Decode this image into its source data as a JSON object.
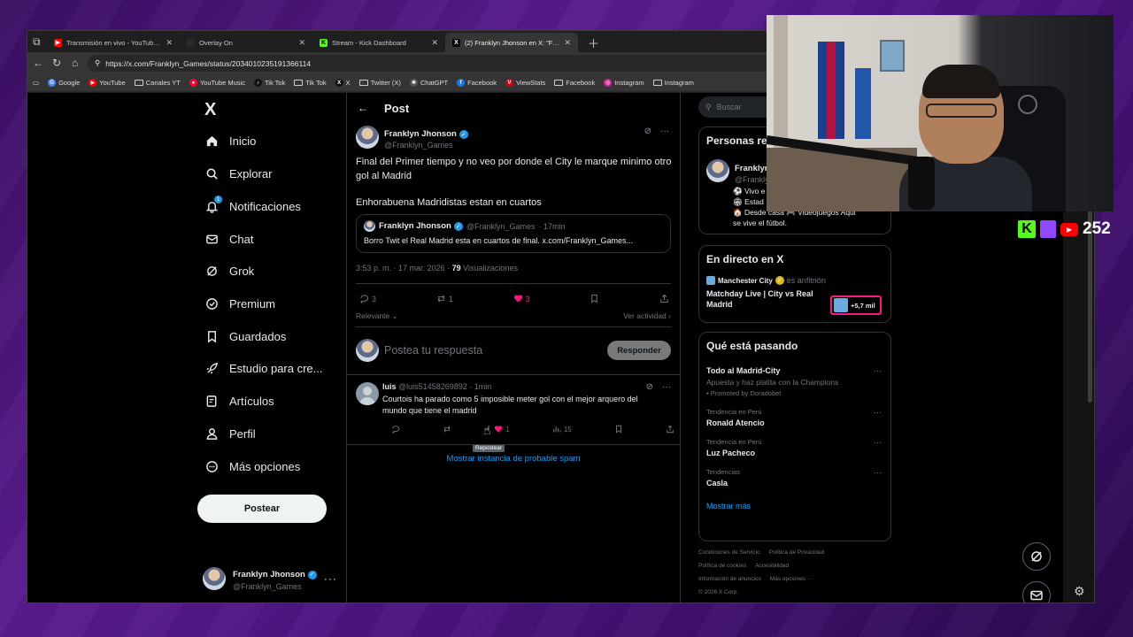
{
  "browser": {
    "tabs": [
      {
        "title": "Transmisión en vivo - YouTube St",
        "favicon_color": "#ff0000",
        "favicon_glyph": "▶"
      },
      {
        "title": "Overlay On",
        "favicon_color": "#2a2a2a",
        "favicon_glyph": ""
      },
      {
        "title": "Stream - Kick Dashboard",
        "favicon_color": "#53fc18",
        "favicon_glyph": "K"
      },
      {
        "title": "(2) Franklyn Jhonson en X: \"Final d",
        "favicon_color": "#000000",
        "favicon_glyph": "X",
        "active": true
      }
    ],
    "url": "https://x.com/Franklyn_Games/status/2034010235191366114",
    "bookmarks": [
      {
        "label": "Google",
        "icon": "google-icon",
        "color": "#4285f4"
      },
      {
        "label": "YouTube",
        "icon": "youtube-icon",
        "color": "#ff0000"
      },
      {
        "label": "Canales YT",
        "icon": "folder-icon"
      },
      {
        "label": "YouTube Music",
        "icon": "youtube-music-icon",
        "color": "#ff0033"
      },
      {
        "label": "Tik Tok",
        "icon": "tiktok-icon",
        "color": "#111111"
      },
      {
        "label": "Tik Tok",
        "icon": "folder-icon"
      },
      {
        "label": "X",
        "icon": "x-icon",
        "color": "#111111"
      },
      {
        "label": "Twitter (X)",
        "icon": "folder-icon"
      },
      {
        "label": "ChatGPT",
        "icon": "chatgpt-icon",
        "color": "#555555"
      },
      {
        "label": "Facebook",
        "icon": "facebook-icon",
        "color": "#1877f2"
      },
      {
        "label": "ViewStats",
        "icon": "viewstats-icon",
        "color": "#d0021b"
      },
      {
        "label": "Facebook",
        "icon": "folder-icon"
      },
      {
        "label": "Instagram",
        "icon": "instagram-icon",
        "color": "#d6249f"
      },
      {
        "label": "Instagram",
        "icon": "folder-icon"
      }
    ]
  },
  "sidebar": {
    "logo": "X",
    "items": [
      {
        "label": "Inicio",
        "icon": "home-icon"
      },
      {
        "label": "Explorar",
        "icon": "search-icon"
      },
      {
        "label": "Notificaciones",
        "icon": "bell-icon",
        "badge": "1"
      },
      {
        "label": "Chat",
        "icon": "mail-icon"
      },
      {
        "label": "Grok",
        "icon": "grok-icon"
      },
      {
        "label": "Premium",
        "icon": "premium-icon"
      },
      {
        "label": "Guardados",
        "icon": "bookmark-icon"
      },
      {
        "label": "Estudio para cre...",
        "icon": "rocket-icon"
      },
      {
        "label": "Artículos",
        "icon": "articles-icon"
      },
      {
        "label": "Perfil",
        "icon": "person-icon"
      },
      {
        "label": "Más opciones",
        "icon": "more-circle-icon"
      }
    ],
    "post_button": "Postear",
    "account": {
      "name": "Franklyn Jhonson",
      "handle": "@Franklyn_Games"
    }
  },
  "main": {
    "header": "Post",
    "post": {
      "author": "Franklyn Jhonson",
      "handle": "@Franklyn_Games",
      "text_line1": "Final del Primer tiempo y no veo por donde el City le marque minimo otro gol al Madrid",
      "text_line2": "Enhorabuena Madridistas estan en cuartos",
      "quote": {
        "author": "Franklyn Jhonson",
        "handle": "@Franklyn_Games",
        "time": "· 17min",
        "text": "Borro Twit el Real Madrid esta en cuartos de final. x.com/Franklyn_Games..."
      },
      "timestamp": "3:53 p. m. · 17 mar. 2026 · ",
      "views_count": "79",
      "views_label": " Visualizaciones",
      "replies": "3",
      "reposts": "1",
      "likes": "3"
    },
    "sort_label": "Relevante",
    "activity_label": "Ver actividad",
    "compose_placeholder": "Postea tu respuesta",
    "reply_button": "Responder",
    "reply": {
      "author": "luis",
      "handle": "@luis51458269892",
      "time": "· 1min",
      "text": "Courtois ha parado como 5 imposible meter gol con el mejor arquero del mundo que tiene el madrid",
      "likes": "1",
      "views": "15",
      "tooltip": "Repostear"
    },
    "spam_link": "Mostrar instancia de probable spam"
  },
  "right": {
    "search_placeholder": "Buscar",
    "who_to_follow_title": "Personas re",
    "profile": {
      "name": "Franklyn",
      "handle": "@Frankly",
      "bio1": "⚽ Vivo e",
      "bio2": "🏟 Estad",
      "bio3": "🏠 Desde casa 🎮 Videojuegos Aqui",
      "bio4": "se vive el fútbol."
    },
    "live": {
      "title": "En directo en X",
      "host_name": "Manchester City",
      "host_suffix": "es anfitrión",
      "event": "Matchday Live | City vs Real Madrid",
      "views": "+5,7 mil"
    },
    "trends": {
      "title": "Qué está pasando",
      "items": [
        {
          "context": "",
          "name": "Todo al Madrid-City",
          "sub": "Apuesta y haz platita con la Champions",
          "promo": "Promoted by Doradobet"
        },
        {
          "context": "Tendencia en Perú",
          "name": "Ronald Atencio",
          "sub": "",
          "promo": ""
        },
        {
          "context": "Tendencia en Perú",
          "name": "Luz Pacheco",
          "sub": "",
          "promo": ""
        },
        {
          "context": "Tendencias",
          "name": "Casla",
          "sub": "",
          "promo": ""
        }
      ],
      "show_more": "Mostrar más"
    },
    "footer": {
      "l1a": "Condiciones de Servicio",
      "l1b": "Política de Privacidad",
      "l2a": "Política de cookies",
      "l2b": "Accesibilidad",
      "l3a": "Información de anuncios",
      "l3b": "Más opciones ···",
      "l4": "© 2026 X Corp."
    }
  },
  "stream_overlay": {
    "viewer_count": "252"
  }
}
